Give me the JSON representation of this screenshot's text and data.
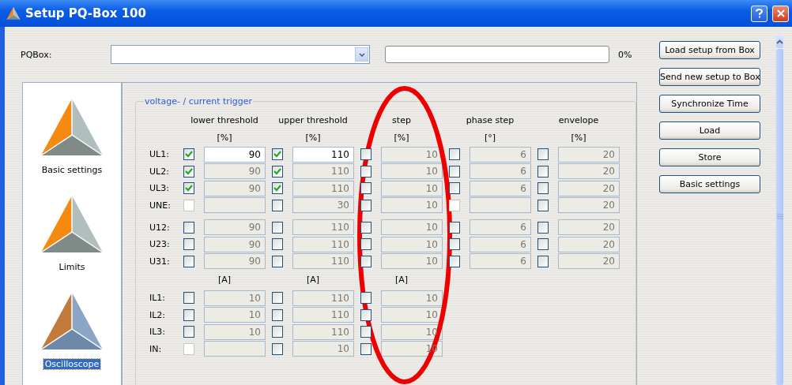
{
  "window": {
    "title": "Setup PQ-Box 100"
  },
  "device": {
    "label": "PQBox:",
    "progress": {
      "level": 0,
      "reading": "0%"
    }
  },
  "sidebar": {
    "items": [
      {
        "label": "Basic settings",
        "selected": false
      },
      {
        "label": "Limits",
        "selected": false
      },
      {
        "label": "Oscilloscope",
        "selected": true
      }
    ]
  },
  "trigger_group": {
    "title": "voltage- / current trigger",
    "columns": [
      "lower threshold",
      "upper threshold",
      "step",
      "phase step",
      "envelope"
    ],
    "sections": [
      {
        "units": [
          "[%]",
          "[%]",
          "[%]",
          "[°]",
          "[%]"
        ],
        "blocks": [
          [
            {
              "label": "UL1:",
              "cells": [
                {
                  "checked": true,
                  "disabled": false,
                  "editable": true,
                  "value": "90"
                },
                {
                  "checked": true,
                  "disabled": false,
                  "editable": true,
                  "value": "110"
                },
                {
                  "checked": false,
                  "disabled": false,
                  "editable": false,
                  "value": "10"
                },
                {
                  "checked": false,
                  "disabled": false,
                  "editable": false,
                  "value": "6"
                },
                {
                  "checked": false,
                  "disabled": false,
                  "editable": false,
                  "value": "20"
                }
              ]
            },
            {
              "label": "UL2:",
              "cells": [
                {
                  "checked": true,
                  "disabled": false,
                  "editable": false,
                  "value": "90"
                },
                {
                  "checked": true,
                  "disabled": false,
                  "editable": false,
                  "value": "110"
                },
                {
                  "checked": false,
                  "disabled": false,
                  "editable": false,
                  "value": "10"
                },
                {
                  "checked": false,
                  "disabled": false,
                  "editable": false,
                  "value": "6"
                },
                {
                  "checked": false,
                  "disabled": false,
                  "editable": false,
                  "value": "20"
                }
              ]
            },
            {
              "label": "UL3:",
              "cells": [
                {
                  "checked": true,
                  "disabled": false,
                  "editable": false,
                  "value": "90"
                },
                {
                  "checked": true,
                  "disabled": false,
                  "editable": false,
                  "value": "110"
                },
                {
                  "checked": false,
                  "disabled": false,
                  "editable": false,
                  "value": "10"
                },
                {
                  "checked": false,
                  "disabled": false,
                  "editable": false,
                  "value": "6"
                },
                {
                  "checked": false,
                  "disabled": false,
                  "editable": false,
                  "value": "20"
                }
              ]
            },
            {
              "label": "UNE:",
              "cells": [
                {
                  "checked": false,
                  "disabled": true,
                  "editable": false
                },
                {
                  "checked": false,
                  "disabled": false,
                  "editable": false,
                  "value": "30"
                },
                {
                  "checked": false,
                  "disabled": false,
                  "editable": false,
                  "value": "10"
                },
                {
                  "checked": false,
                  "disabled": true,
                  "editable": false
                },
                {
                  "checked": false,
                  "disabled": false,
                  "editable": false,
                  "value": "20"
                }
              ]
            }
          ],
          [
            {
              "label": "U12:",
              "cells": [
                {
                  "checked": false,
                  "disabled": false,
                  "editable": false,
                  "value": "90"
                },
                {
                  "checked": false,
                  "disabled": false,
                  "editable": false,
                  "value": "110"
                },
                {
                  "checked": false,
                  "disabled": false,
                  "editable": false,
                  "value": "10"
                },
                {
                  "checked": false,
                  "disabled": false,
                  "editable": false,
                  "value": "6"
                },
                {
                  "checked": false,
                  "disabled": false,
                  "editable": false,
                  "value": "20"
                }
              ]
            },
            {
              "label": "U23:",
              "cells": [
                {
                  "checked": false,
                  "disabled": false,
                  "editable": false,
                  "value": "90"
                },
                {
                  "checked": false,
                  "disabled": false,
                  "editable": false,
                  "value": "110"
                },
                {
                  "checked": false,
                  "disabled": false,
                  "editable": false,
                  "value": "10"
                },
                {
                  "checked": false,
                  "disabled": false,
                  "editable": false,
                  "value": "6"
                },
                {
                  "checked": false,
                  "disabled": false,
                  "editable": false,
                  "value": "20"
                }
              ]
            },
            {
              "label": "U31:",
              "cells": [
                {
                  "checked": false,
                  "disabled": false,
                  "editable": false,
                  "value": "90"
                },
                {
                  "checked": false,
                  "disabled": false,
                  "editable": false,
                  "value": "110"
                },
                {
                  "checked": false,
                  "disabled": false,
                  "editable": false,
                  "value": "10"
                },
                {
                  "checked": false,
                  "disabled": false,
                  "editable": false,
                  "value": "6"
                },
                {
                  "checked": false,
                  "disabled": false,
                  "editable": false,
                  "value": "20"
                }
              ]
            }
          ]
        ]
      },
      {
        "units": [
          "[A]",
          "[A]",
          "[A]"
        ],
        "blocks": [
          [
            {
              "label": "IL1:",
              "cells": [
                {
                  "checked": false,
                  "disabled": false,
                  "editable": false,
                  "value": "10"
                },
                {
                  "checked": false,
                  "disabled": false,
                  "editable": false,
                  "value": "110"
                },
                {
                  "checked": false,
                  "disabled": false,
                  "editable": false,
                  "value": "10"
                }
              ]
            },
            {
              "label": "IL2:",
              "cells": [
                {
                  "checked": false,
                  "disabled": false,
                  "editable": false,
                  "value": "10"
                },
                {
                  "checked": false,
                  "disabled": false,
                  "editable": false,
                  "value": "110"
                },
                {
                  "checked": false,
                  "disabled": false,
                  "editable": false,
                  "value": "10"
                }
              ]
            },
            {
              "label": "IL3:",
              "cells": [
                {
                  "checked": false,
                  "disabled": false,
                  "editable": false,
                  "value": "10"
                },
                {
                  "checked": false,
                  "disabled": false,
                  "editable": false,
                  "value": "110"
                },
                {
                  "checked": false,
                  "disabled": false,
                  "editable": false,
                  "value": "10"
                }
              ]
            },
            {
              "label": "IN:",
              "cells": [
                {
                  "checked": false,
                  "disabled": true,
                  "editable": false
                },
                {
                  "checked": false,
                  "disabled": false,
                  "editable": false,
                  "value": "10"
                },
                {
                  "checked": false,
                  "disabled": false,
                  "editable": false,
                  "value": "10"
                }
              ]
            }
          ]
        ]
      }
    ]
  },
  "buttons": [
    "Load setup from Box",
    "Send new setup to Box",
    "Synchronize Time",
    "Load",
    "Store",
    "Basic settings"
  ]
}
